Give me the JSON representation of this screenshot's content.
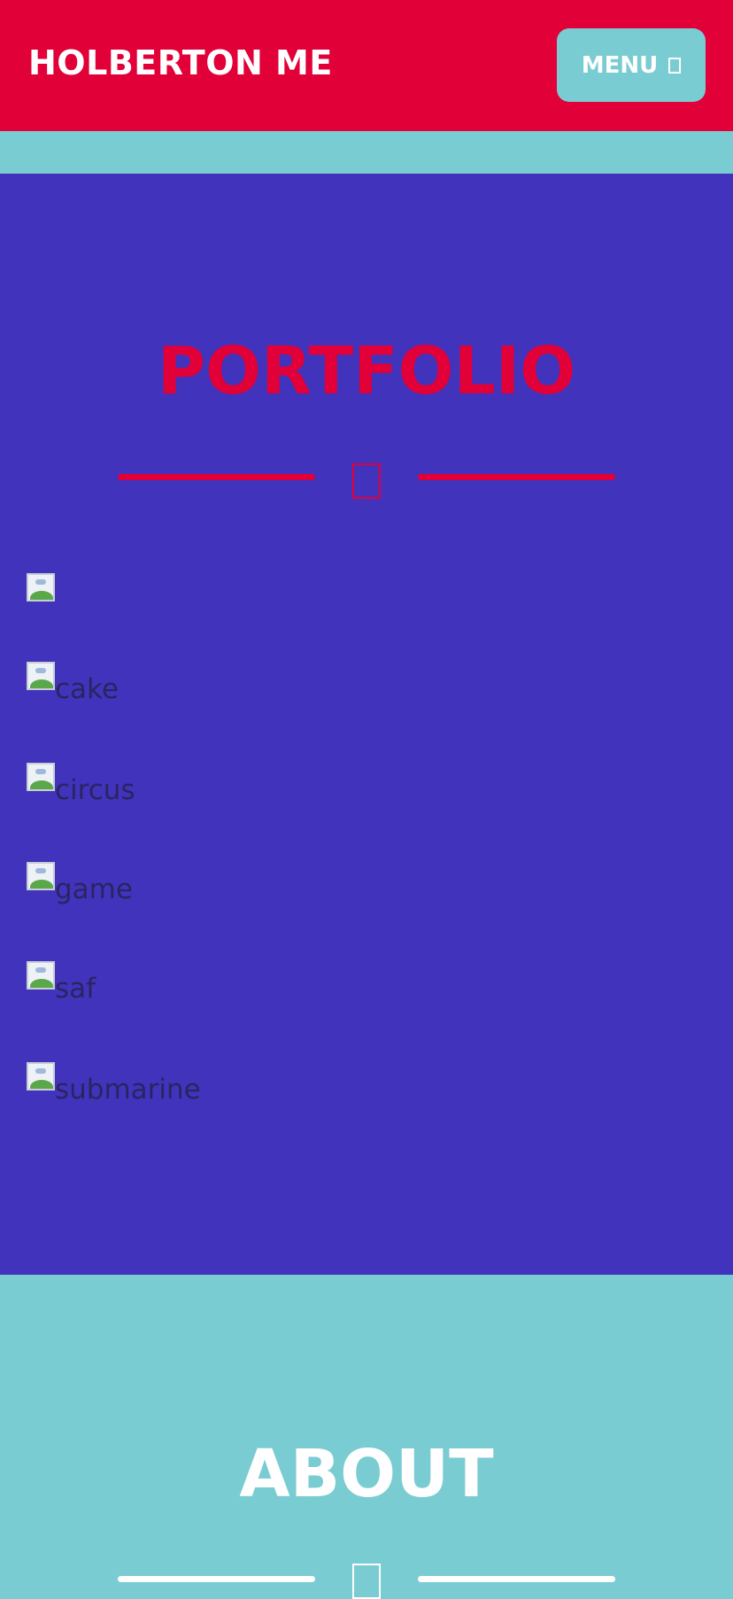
{
  "header": {
    "brand": "HOLBERTON ME",
    "menu_label": "MENU",
    "menu_icon": "bars-icon"
  },
  "portfolio": {
    "title": "PORTFOLIO",
    "divider_icon": "code-icon",
    "items": [
      {
        "alt": ""
      },
      {
        "alt": "cake"
      },
      {
        "alt": "circus"
      },
      {
        "alt": "game"
      },
      {
        "alt": "saf"
      },
      {
        "alt": "submarine"
      }
    ]
  },
  "about": {
    "title": "ABOUT",
    "divider_icon": "user-icon"
  },
  "colors": {
    "primary_red": "#E10038",
    "teal": "#7ACCD3",
    "indigo": "#4133BC",
    "white": "#FFFFFF"
  }
}
